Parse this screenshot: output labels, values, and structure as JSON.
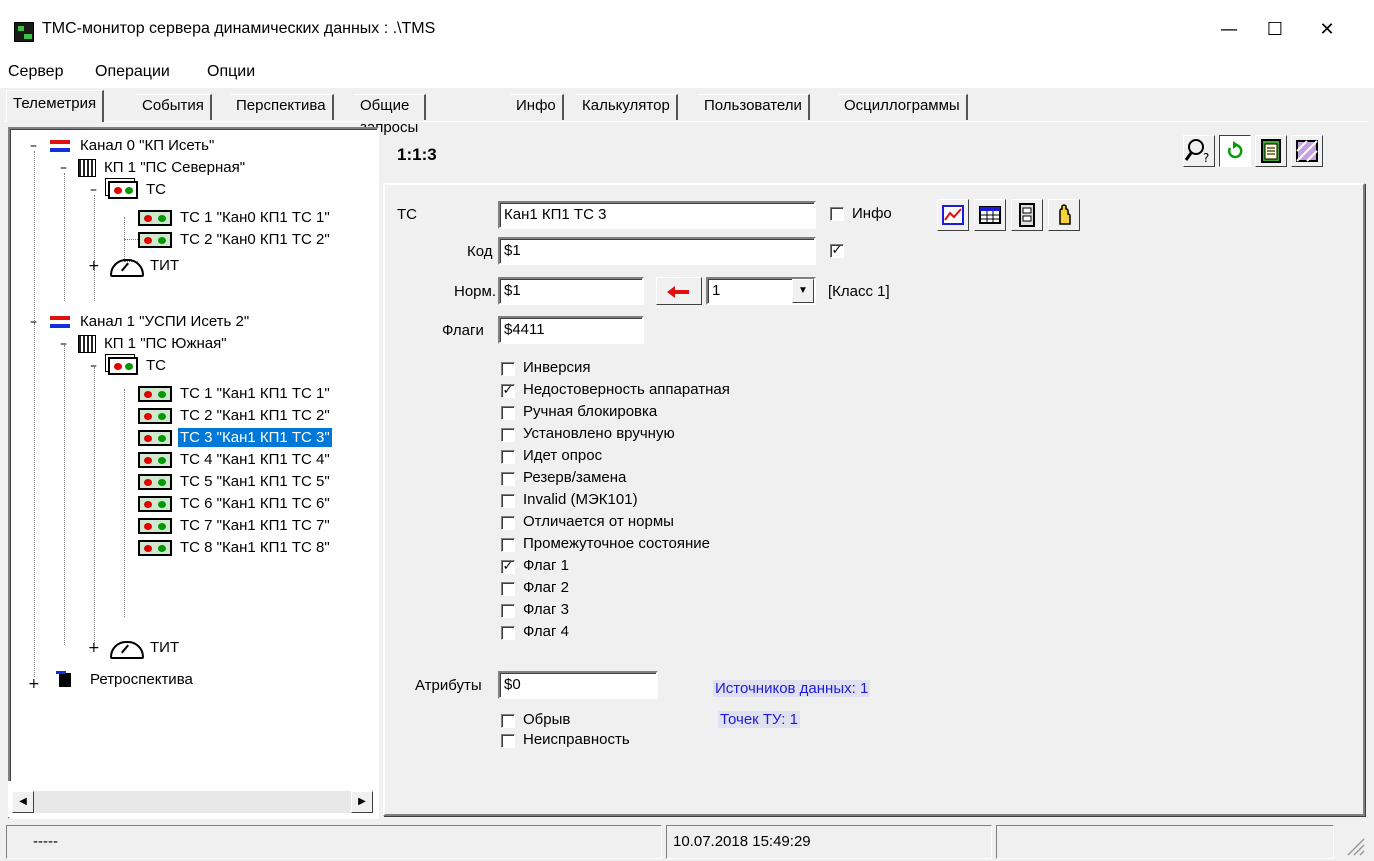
{
  "window": {
    "title": "ТМС-монитор сервера динамических данных :  .\\TMS",
    "controls": {
      "minimize": "—",
      "maximize": "☐",
      "close": "✕"
    }
  },
  "menu": [
    "Сервер",
    "Операции",
    "Опции"
  ],
  "tabs": [
    "Телеметрия",
    "События",
    "Перспектива",
    "Общие запросы",
    "Инфо",
    "Калькулятор",
    "Пользователи",
    "Осциллограммы"
  ],
  "active_tab": "Телеметрия",
  "tree": {
    "channel0": "Канал 0 \"КП Исеть\"",
    "kp0": "КП 1 \"ПС Северная\"",
    "ts_group0": "ТС",
    "ts0": [
      "ТС 1 \"Кан0 КП1 ТС 1\"",
      "ТС 2 \"Кан0 КП1 ТС 2\""
    ],
    "tit0": "ТИТ",
    "channel1": "Канал 1 \"УСПИ Исеть 2\"",
    "kp1": "КП 1 \"ПС Южная\"",
    "ts_group1": "ТС",
    "ts1": [
      "ТС 1 \"Кан1 КП1 ТС 1\"",
      "ТС 2 \"Кан1 КП1 ТС 2\"",
      "ТС 3 \"Кан1 КП1 ТС 3\"",
      "ТС 4 \"Кан1 КП1 ТС 4\"",
      "ТС 5 \"Кан1 КП1 ТС 5\"",
      "ТС 6 \"Кан1 КП1 ТС 6\"",
      "ТС 7 \"Кан1 КП1 ТС 7\"",
      "ТС 8 \"Кан1 КП1 ТС 8\""
    ],
    "selected": "ТС 3 \"Кан1 КП1 ТС 3\"",
    "tit1": "ТИТ",
    "retro": "Ретроспектива",
    "expander_minus": "–",
    "expander_plus": "+"
  },
  "scrollbar": {
    "left": "◀",
    "right": "▶"
  },
  "detail": {
    "address": "1:1:3",
    "type_label": "ТС",
    "name_value": "Кан1 КП1 ТС 3",
    "info_label": "Инфо",
    "info_checked": false,
    "code_label": "Код",
    "code_value": "$1",
    "code_checked": true,
    "norm_label": "Норм.",
    "norm_value": "$1",
    "class_select": "1",
    "class_text": "[Класс 1]",
    "flags_label": "Флаги",
    "flags_value": "$4411",
    "flags": [
      {
        "label": "Инверсия",
        "checked": false
      },
      {
        "label": "Недостоверность аппаратная",
        "checked": true
      },
      {
        "label": "Ручная блокировка",
        "checked": false
      },
      {
        "label": "Установлено вручную",
        "checked": false
      },
      {
        "label": "Идет опрос",
        "checked": false
      },
      {
        "label": "Резерв/замена",
        "checked": false
      },
      {
        "label": "Invalid (МЭК101)",
        "checked": false
      },
      {
        "label": "Отличается от нормы",
        "checked": false
      },
      {
        "label": "Промежуточное состояние",
        "checked": false
      },
      {
        "label": "Флаг 1",
        "checked": true
      },
      {
        "label": "Флаг 2",
        "checked": false
      },
      {
        "label": "Флаг 3",
        "checked": false
      },
      {
        "label": "Флаг 4",
        "checked": false
      }
    ],
    "attrs_label": "Атрибуты",
    "attrs_value": "$0",
    "sources_text": "Источников данных: 1",
    "tu_points_text": "Точек ТУ: 1",
    "bottom_flags": [
      {
        "label": "Обрыв",
        "checked": false
      },
      {
        "label": "Неисправность",
        "checked": false
      }
    ],
    "check_mark": "✓"
  },
  "toolbar_icons": [
    "search-help-icon",
    "refresh-icon",
    "clipboard-icon",
    "pattern-icon"
  ],
  "field_icons": [
    "graph-icon",
    "table-icon",
    "archive-icon",
    "hand-icon"
  ],
  "status": {
    "left": "-----",
    "datetime": "10.07.2018 15:49:29",
    "right": ""
  },
  "colors": {
    "selection": "#0078d7",
    "info_blue": "#1c1cd8",
    "arrow_red": "#e01010"
  }
}
